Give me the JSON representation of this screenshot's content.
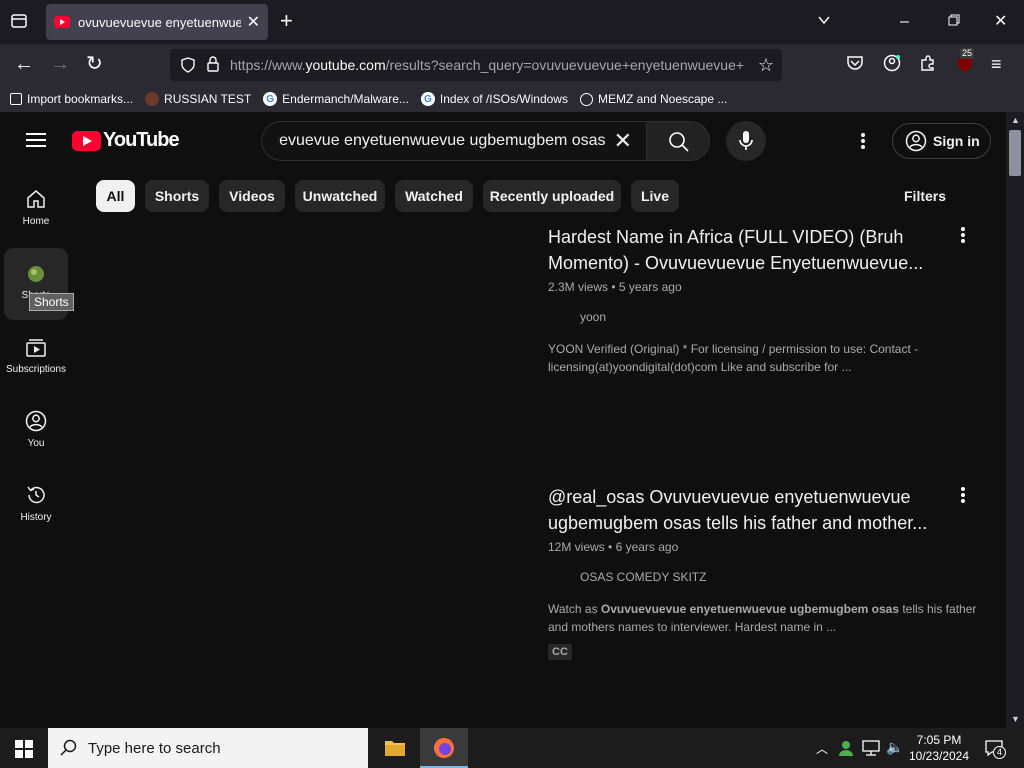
{
  "browser": {
    "tab_title": "ovuvuevuevue enyetuenwuevue",
    "url_prefix": "https://www.",
    "url_domain": "youtube.com",
    "url_rest": "/results?search_query=ovuvuevuevue+enyetuenwuevue+",
    "extension_badge": "25",
    "bookmarks": [
      {
        "label": "Import bookmarks...",
        "icon": "import-icon"
      },
      {
        "label": "RUSSIAN TEST",
        "icon": "russian-test-icon"
      },
      {
        "label": "Endermanch/Malware...",
        "icon": "google-icon"
      },
      {
        "label": "Index of /ISOs/Windows",
        "icon": "google-icon"
      },
      {
        "label": "MEMZ and Noescape ...",
        "icon": "globe-icon"
      }
    ]
  },
  "youtube": {
    "logo_text": "YouTube",
    "search_query": "ovuvuevuevue enyetuenwuevue ugbemugbem osas",
    "sign_in_label": "Sign in",
    "sidebar": [
      {
        "label": "Home",
        "icon": "home-icon"
      },
      {
        "label": "Shorts",
        "icon": "shorts-icon"
      },
      {
        "label": "Subscriptions",
        "icon": "subscriptions-icon"
      },
      {
        "label": "You",
        "icon": "you-icon"
      },
      {
        "label": "History",
        "icon": "history-icon"
      }
    ],
    "tooltip": "Shorts",
    "chips": [
      "All",
      "Shorts",
      "Videos",
      "Unwatched",
      "Watched",
      "Recently uploaded",
      "Live"
    ],
    "filters_label": "Filters",
    "results": [
      {
        "title": "Hardest Name in Africa (FULL VIDEO) (Bruh Momento) - Ovuvuevuevue Enyetuenwuevue...",
        "views": "2.3M views",
        "age": "5 years ago",
        "channel": "yoon",
        "description": "YOON Verified (Original) * For licensing / permission to use: Contact - licensing(at)yoondigital(dot)com Like and subscribe for ..."
      },
      {
        "title": "@real_osas Ovuvuevuevue enyetuenwuevue ugbemugbem osas tells his father and mother...",
        "views": "12M views",
        "age": "6 years ago",
        "channel": "OSAS COMEDY SKITZ",
        "description_prefix": "Watch as ",
        "description_bold": "Ovuvuevuevue enyetuenwuevue ugbemugbem osas",
        "description_suffix": " tells his father and mothers names to interviewer. Hardest name in ...",
        "badge": "CC"
      }
    ]
  },
  "taskbar": {
    "search_placeholder": "Type here to search",
    "time": "7:05 PM",
    "date": "10/23/2024",
    "notification_count": "4"
  }
}
